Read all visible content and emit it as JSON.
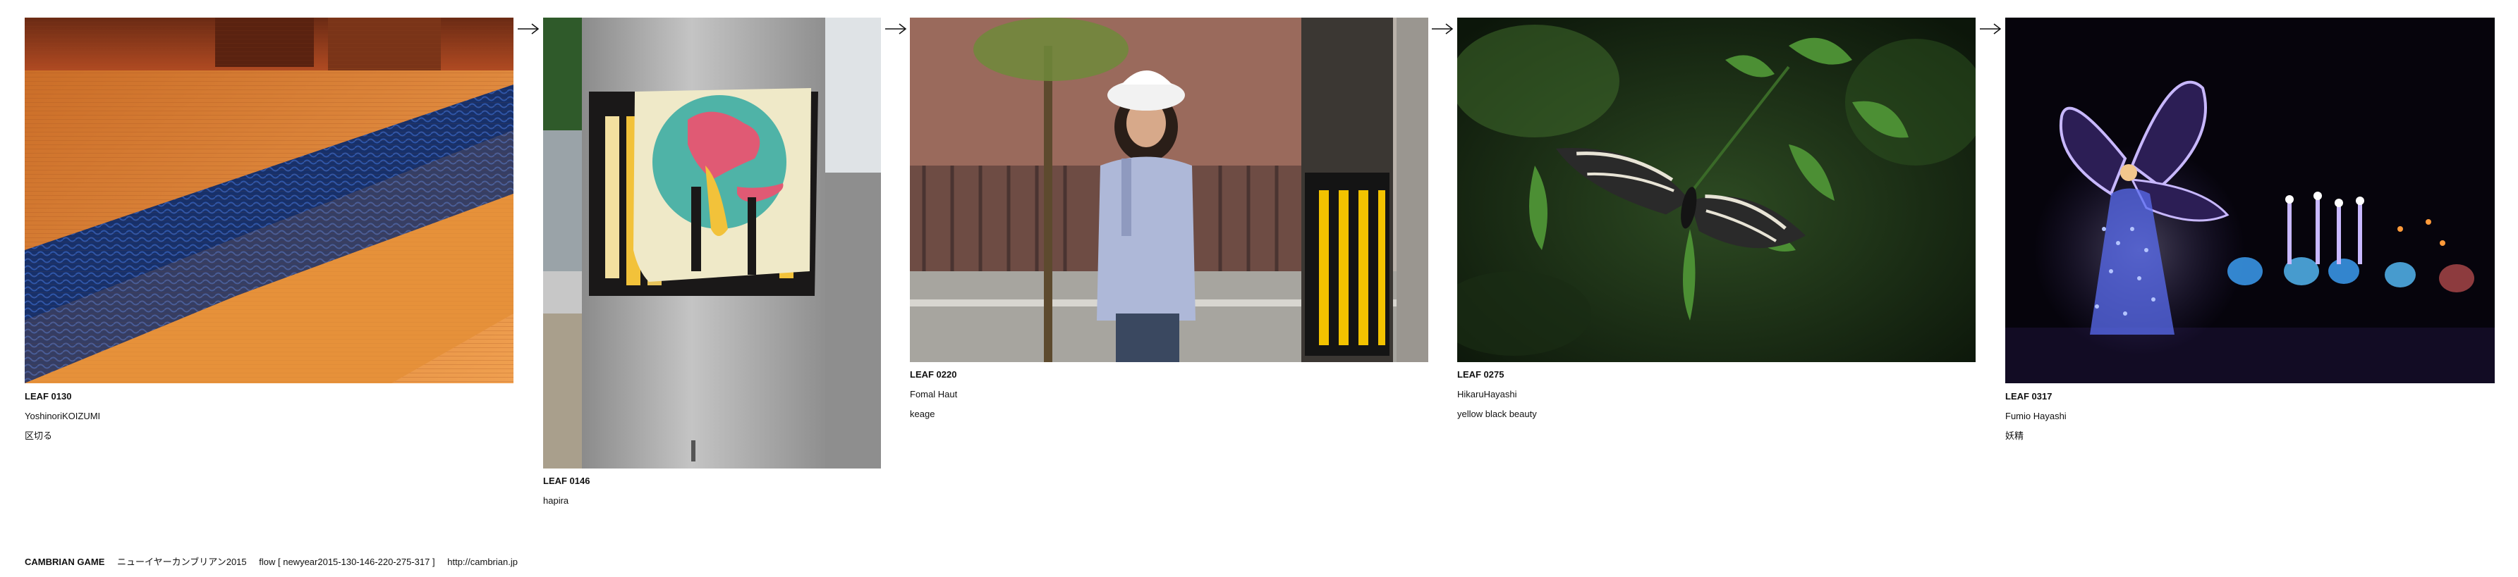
{
  "leaves": [
    {
      "id": "LEAF 0130",
      "author": "YoshinoriKOIZUMI",
      "title": "区切る"
    },
    {
      "id": "LEAF 0146",
      "author": "",
      "title": "hapira"
    },
    {
      "id": "LEAF 0220",
      "author": "Fomal Haut",
      "title": "keage"
    },
    {
      "id": "LEAF 0275",
      "author": "HikaruHayashi",
      "title": "yellow black beauty"
    },
    {
      "id": "LEAF 0317",
      "author": "Fumio Hayashi",
      "title": "妖精"
    }
  ],
  "arrows": [
    "→",
    "→",
    "→",
    "→"
  ],
  "footer": {
    "brand": "CAMBRIAN GAME",
    "flow_title": "ニューイヤーカンブリアン2015",
    "flow_label": "flow [ newyear2015-130-146-220-275-317 ]",
    "url": "http://cambrian.jp"
  },
  "colors": {
    "background": "#ffffff",
    "text": "#111111",
    "tatami_orange": "#e0832f",
    "tatami_border_blue": "#1c3a78",
    "pole_gray": "#a9a9a9",
    "butterfly_leaf_green": "#3d7d2e",
    "fairy_light_purple": "#9a7df0"
  },
  "icons": [
    "right-arrow-icon"
  ]
}
